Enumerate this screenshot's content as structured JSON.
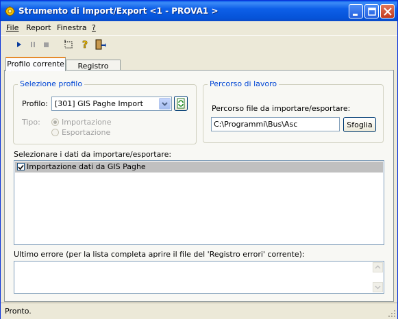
{
  "window": {
    "title": "Strumento di Import/Export <1 - PROVA1 >"
  },
  "menu": [
    {
      "label": "File"
    },
    {
      "label": "Report"
    },
    {
      "label": "Finestra"
    },
    {
      "label": "?"
    }
  ],
  "toolbar": {
    "icons": [
      "play-icon",
      "pause-icon",
      "stop-icon",
      "select-icon",
      "help-icon",
      "exit-icon"
    ]
  },
  "tabs": [
    {
      "label": "Profilo corrente",
      "active": true
    },
    {
      "label": "Registro errori",
      "active": false
    }
  ],
  "profile_group": {
    "title": "Selezione profilo",
    "profile_label": "Profilo:",
    "profile_value": "[301] GIS Paghe Import",
    "type_label": "Tipo:",
    "type_options": [
      "Importazione",
      "Esportazione"
    ],
    "type_selected": "Importazione"
  },
  "path_group": {
    "title": "Percorso di lavoro",
    "path_label": "Percorso file da importare/esportare:",
    "path_value": "C:\\Programmi\\Bus\\Asc",
    "browse_button": "Sfoglia"
  },
  "data_section": {
    "label": "Selezionare i dati da importare/esportare:",
    "items": [
      {
        "label": "Importazione dati da GIS Paghe",
        "checked": true
      }
    ]
  },
  "error_section": {
    "label": "Ultimo errore (per la lista completa aprire il file del 'Registro errori' corrente):",
    "value": ""
  },
  "status": {
    "text": "Pronto."
  },
  "colors": {
    "title_bar": "#0553d8",
    "group_title": "#0046d5",
    "tab_highlight": "#e68b2c"
  }
}
